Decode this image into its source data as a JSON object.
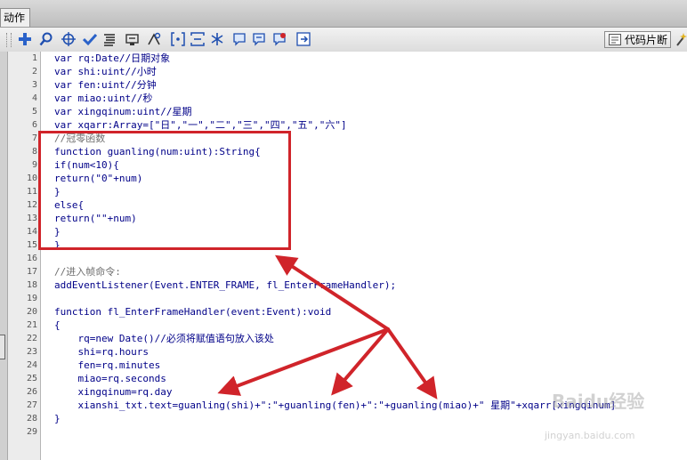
{
  "tab": {
    "label": "动作"
  },
  "toolbar": {
    "icons": [
      "add-icon",
      "find-icon",
      "target-icon",
      "check-icon",
      "format-icon",
      "debug-icon",
      "collapse-icon",
      "expand-icon",
      "expand-all-icon",
      "comment-block-icon",
      "comment-line-icon",
      "uncomment-icon",
      "script-assist-icon"
    ],
    "snippets_label": "代码片断"
  },
  "code_lines": [
    {
      "n": "1",
      "text": "var rq:Date//日期对象"
    },
    {
      "n": "2",
      "text": "var shi:uint//小时"
    },
    {
      "n": "3",
      "text": "var fen:uint//分钟"
    },
    {
      "n": "4",
      "text": "var miao:uint//秒"
    },
    {
      "n": "5",
      "text": "var xingqinum:uint//星期"
    },
    {
      "n": "6",
      "text": "var xqarr:Array=[\"日\",\"一\",\"二\",\"三\",\"四\",\"五\",\"六\"]"
    },
    {
      "n": "7",
      "text": "//冠零函数"
    },
    {
      "n": "8",
      "text": "function guanling(num:uint):String{"
    },
    {
      "n": "9",
      "text": "if(num<10){"
    },
    {
      "n": "10",
      "text": "return(\"0\"+num)"
    },
    {
      "n": "11",
      "text": "}"
    },
    {
      "n": "12",
      "text": "else{"
    },
    {
      "n": "13",
      "text": "return(\"\"+num)"
    },
    {
      "n": "14",
      "text": "}"
    },
    {
      "n": "15",
      "text": "}"
    },
    {
      "n": "16",
      "text": ""
    },
    {
      "n": "17",
      "text": "//进入帧命令:"
    },
    {
      "n": "18",
      "text": "addEventListener(Event.ENTER_FRAME, fl_EnterFrameHandler);"
    },
    {
      "n": "19",
      "text": ""
    },
    {
      "n": "20",
      "text": "function fl_EnterFrameHandler(event:Event):void"
    },
    {
      "n": "21",
      "text": "{"
    },
    {
      "n": "22",
      "text": "    rq=new Date()//必须将赋值语句放入该处"
    },
    {
      "n": "23",
      "text": "    shi=rq.hours"
    },
    {
      "n": "24",
      "text": "    fen=rq.minutes"
    },
    {
      "n": "25",
      "text": "    miao=rq.seconds"
    },
    {
      "n": "26",
      "text": "    xingqinum=rq.day"
    },
    {
      "n": "27",
      "text": "    xianshi_txt.text=guanling(shi)+\":\"+guanling(fen)+\":\"+guanling(miao)+\" 星期\"+xqarr[xingqinum]"
    },
    {
      "n": "28",
      "text": "}"
    },
    {
      "n": "29",
      "text": ""
    }
  ],
  "annotation": {
    "color": "#d0242a"
  },
  "watermark": {
    "line1": "Baidu经验",
    "line2": "jingyan.baidu.com"
  }
}
